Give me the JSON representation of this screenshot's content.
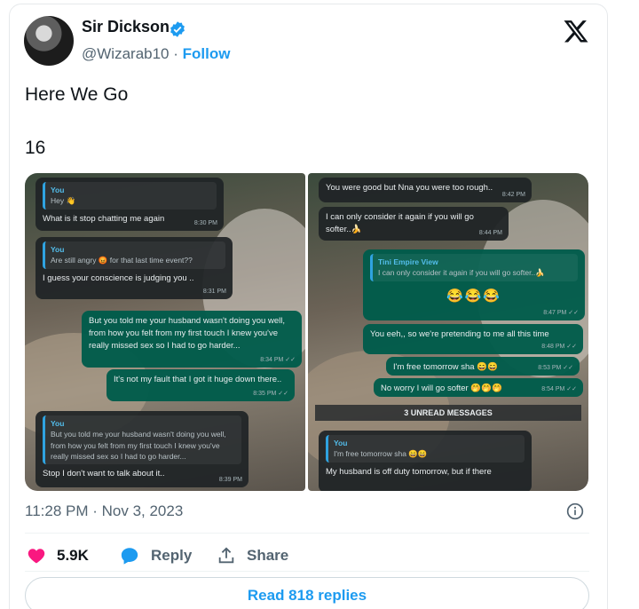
{
  "author": {
    "name": "Sir Dickson",
    "handle": "@Wizarab10",
    "separator": "·",
    "follow_label": "Follow"
  },
  "tweet": {
    "text_line1": "Here We Go",
    "text_line2": "16"
  },
  "left_chat": {
    "b1_quote_who": "You",
    "b1_quote_txt": "Hey 👋",
    "b1_text": "What is it stop chatting me again",
    "b1_time": "8:30 PM",
    "b2_quote_who": "You",
    "b2_quote_txt": "Are still angry 😡 for that last time event??",
    "b2_text": "I guess your conscience is judging you ..",
    "b2_time": "8:31 PM",
    "b3_text": "But you told me your husband wasn't doing you well, from how you felt from my first touch I knew you've really missed sex so I had to go harder...",
    "b3_time": "8:34 PM ✓✓",
    "b4_text": "It's not my fault that I got it huge down there..",
    "b4_time": "8:35 PM ✓✓",
    "b5_quote_who": "You",
    "b5_quote_txt": "But you told me your husband wasn't doing you well, from how you felt from my first touch I knew you've really missed sex so I had to go harder...",
    "b5_text": "Stop I don't want to talk about it..",
    "b5_time": "8:39 PM"
  },
  "right_chat": {
    "b1_text": "You were good but Nna you were too rough..",
    "b1_time": "8:42 PM",
    "b2_text": "I can only consider it again if you will go softer..🍌",
    "b2_time": "8:44 PM",
    "b3_quote_who": "Tini Empire View",
    "b3_quote_txt": "I can only consider it again if you will go softer..🍌",
    "b3_emojis": "😂😂😂",
    "b3_time": "8:47 PM ✓✓",
    "b4_text": "You eeh,, so we're pretending to me all this time",
    "b4_time": "8:48 PM ✓✓",
    "b5_text": "I'm free tomorrow sha 😄😄",
    "b5_time": "8:53 PM ✓✓",
    "b6_text": "No worry I will go softer 🤭🤭🤭",
    "b6_time": "8:54 PM ✓✓",
    "unread": "3 UNREAD MESSAGES",
    "b7_quote_who": "You",
    "b7_quote_txt": "I'm free tomorrow sha 😄😄",
    "b7_text": "My husband is off duty tomorrow, but if there"
  },
  "meta": {
    "timestamp": "11:28 PM · Nov 3, 2023"
  },
  "actions": {
    "likes": "5.9K",
    "reply_label": "Reply",
    "share_label": "Share"
  },
  "read_replies_label": "Read 818 replies",
  "colors": {
    "accent": "#1d9bf0",
    "like": "#f91880",
    "text": "#0f1419",
    "muted": "#536471"
  }
}
